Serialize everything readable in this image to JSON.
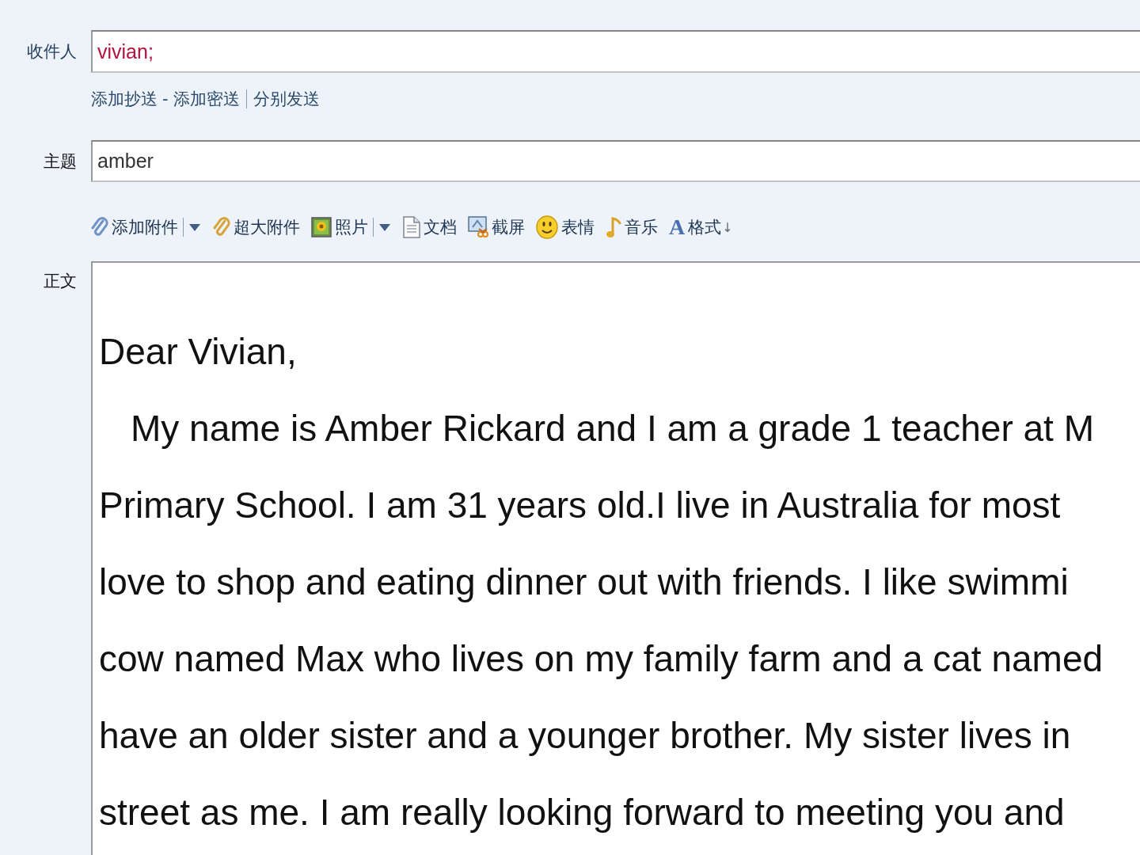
{
  "recipient": {
    "label": "收件人",
    "value": "vivian;"
  },
  "links": [
    {
      "kind": "link",
      "label": "添加抄送"
    },
    {
      "kind": "text",
      "label": "-"
    },
    {
      "kind": "link",
      "label": "添加密送"
    },
    {
      "kind": "rule"
    },
    {
      "kind": "link",
      "label": "分别发送"
    }
  ],
  "subject": {
    "label": "主题",
    "value": "amber"
  },
  "toolbar": [
    {
      "kind": "button",
      "label": "添加附件"
    },
    {
      "kind": "dropdown"
    },
    {
      "kind": "button",
      "label": "超大附件"
    },
    {
      "kind": "button",
      "label": "照片"
    },
    {
      "kind": "dropdown"
    },
    {
      "kind": "button",
      "label": "文档"
    },
    {
      "kind": "button",
      "label": "截屏"
    },
    {
      "kind": "button",
      "label": "表情"
    },
    {
      "kind": "button",
      "label": "音乐"
    },
    {
      "kind": "format",
      "icon_char": "A",
      "label": "格式",
      "suffix": "↓"
    }
  ],
  "body": {
    "label": "正文",
    "greeting": "Dear Vivian,",
    "paragraph": {
      "lines": [
        "My name is Amber Rickard and I am a grade 1 teacher at M",
        "Primary School. I am 31 years old.I live in Australia for most",
        "love to shop and eating dinner out with friends. I like swimmi",
        "cow named Max who lives on my family farm and a cat named",
        "have an older sister and a younger brother. My sister lives in",
        "street as me. I am really looking forward to meeting you and"
      ]
    }
  }
}
